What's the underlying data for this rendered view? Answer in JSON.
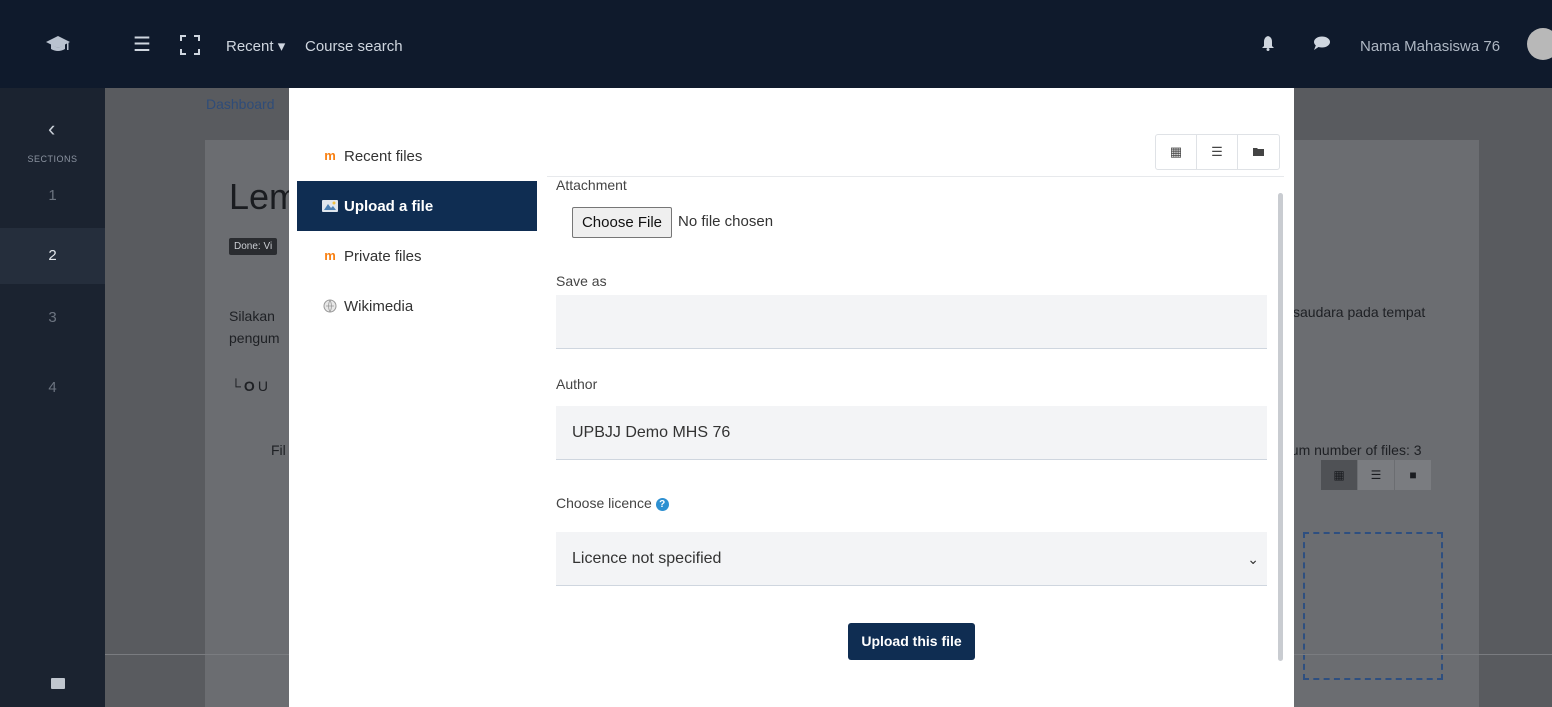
{
  "navbar": {
    "logo_icon": "graduation-cap-icon",
    "menu_icon": "hamburger-menu-icon",
    "fullscreen_icon": "fullscreen-icon",
    "recent_label": "Recent ▾",
    "course_search_label": "Course search",
    "user_name": "Nama Mahasiswa 76"
  },
  "sections_sidebar": {
    "title": "SECTIONS",
    "back_glyph": "‹",
    "items": [
      "1",
      "2",
      "3",
      "4"
    ],
    "active_item": "2"
  },
  "page": {
    "breadcrumb": "Dashboard",
    "title_visible": "Lem",
    "done_badge": "Done: Vi",
    "text_line1": "Silakan",
    "text_line2": "pengum",
    "text_right": "saudara pada tempat",
    "link_visible": "U",
    "files_label_visible": "Fil",
    "max_files_visible": "num number of files: 3"
  },
  "file_picker": {
    "repositories": [
      {
        "label": "Recent files",
        "icon": "moodle-m-icon"
      },
      {
        "label": "Upload a file",
        "icon": "upload-icon"
      },
      {
        "label": "Private files",
        "icon": "moodle-m-icon"
      },
      {
        "label": "Wikimedia",
        "icon": "wikimedia-icon"
      }
    ],
    "active_repository": "Upload a file",
    "view_modes": [
      "icons-view",
      "list-view",
      "tree-view"
    ],
    "attachment_label": "Attachment",
    "choose_file_button": "Choose File",
    "no_file_text": "No file chosen",
    "save_as_label": "Save as",
    "save_as_value": "",
    "author_label": "Author",
    "author_value": "UPBJJ Demo MHS 76",
    "licence_label": "Choose licence",
    "licence_value": "Licence not specified",
    "upload_button": "Upload this file"
  },
  "colors": {
    "navbar_bg": "#0f1a2c",
    "primary": "#0f2d52",
    "help_icon": "#2e90d1"
  }
}
